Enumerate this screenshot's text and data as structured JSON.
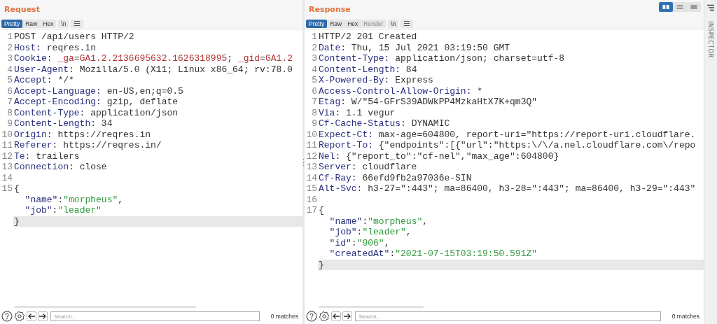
{
  "panes": [
    {
      "title": "Request",
      "tabs": [
        {
          "label": "Pretty",
          "selected": true,
          "disabled": false
        },
        {
          "label": "Raw",
          "selected": false,
          "disabled": false
        },
        {
          "label": "Hex",
          "selected": false,
          "disabled": false
        }
      ],
      "newline_toggle": "\\n",
      "lines": [
        {
          "number": "1",
          "highlighted": false,
          "segments": [
            {
              "kind": "plain",
              "text": "POST /api/users HTTP/2"
            }
          ]
        },
        {
          "number": "2",
          "highlighted": false,
          "segments": [
            {
              "kind": "key",
              "text": "Host:"
            },
            {
              "kind": "plain",
              "text": " reqres.in"
            }
          ]
        },
        {
          "number": "3",
          "highlighted": false,
          "segments": [
            {
              "kind": "key",
              "text": "Cookie:"
            },
            {
              "kind": "cookie",
              "text": " _ga"
            },
            {
              "kind": "plain",
              "text": "="
            },
            {
              "kind": "cookie",
              "text": "GA1.2.2136695632.1626318995"
            },
            {
              "kind": "plain",
              "text": "; "
            },
            {
              "kind": "cookie",
              "text": "_gid"
            },
            {
              "kind": "plain",
              "text": "="
            },
            {
              "kind": "cookie",
              "text": "GA1.2"
            }
          ]
        },
        {
          "number": "4",
          "highlighted": false,
          "segments": [
            {
              "kind": "key",
              "text": "User-Agent:"
            },
            {
              "kind": "plain",
              "text": " Mozilla/5.0 (X11; Linux x86_64; rv:78.0"
            }
          ]
        },
        {
          "number": "5",
          "highlighted": false,
          "segments": [
            {
              "kind": "key",
              "text": "Accept:"
            },
            {
              "kind": "plain",
              "text": " */*"
            }
          ]
        },
        {
          "number": "6",
          "highlighted": false,
          "segments": [
            {
              "kind": "key",
              "text": "Accept-Language:"
            },
            {
              "kind": "plain",
              "text": " en-US,en;q=0.5"
            }
          ]
        },
        {
          "number": "7",
          "highlighted": false,
          "segments": [
            {
              "kind": "key",
              "text": "Accept-Encoding:"
            },
            {
              "kind": "plain",
              "text": " gzip, deflate"
            }
          ]
        },
        {
          "number": "8",
          "highlighted": false,
          "segments": [
            {
              "kind": "key",
              "text": "Content-Type:"
            },
            {
              "kind": "plain",
              "text": " application/json"
            }
          ]
        },
        {
          "number": "9",
          "highlighted": false,
          "segments": [
            {
              "kind": "key",
              "text": "Content-Length:"
            },
            {
              "kind": "plain",
              "text": " 34"
            }
          ]
        },
        {
          "number": "10",
          "highlighted": false,
          "segments": [
            {
              "kind": "key",
              "text": "Origin:"
            },
            {
              "kind": "plain",
              "text": " https://reqres.in"
            }
          ]
        },
        {
          "number": "11",
          "highlighted": false,
          "segments": [
            {
              "kind": "key",
              "text": "Referer:"
            },
            {
              "kind": "plain",
              "text": " https://reqres.in/"
            }
          ]
        },
        {
          "number": "12",
          "highlighted": false,
          "segments": [
            {
              "kind": "key",
              "text": "Te:"
            },
            {
              "kind": "plain",
              "text": " trailers"
            }
          ]
        },
        {
          "number": "13",
          "highlighted": false,
          "segments": [
            {
              "kind": "key",
              "text": "Connection:"
            },
            {
              "kind": "plain",
              "text": " close"
            }
          ]
        },
        {
          "number": "14",
          "highlighted": false
        },
        {
          "number": "15",
          "highlighted": false,
          "segments": [
            {
              "kind": "plain",
              "text": "{"
            }
          ]
        },
        {
          "highlighted": false,
          "segments": [
            {
              "kind": "jsonkey",
              "text": "  \"name\""
            },
            {
              "kind": "plain",
              "text": ":"
            },
            {
              "kind": "string",
              "text": "\"morpheus\""
            },
            {
              "kind": "plain",
              "text": ","
            }
          ]
        },
        {
          "highlighted": false,
          "segments": [
            {
              "kind": "jsonkey",
              "text": "  \"job\""
            },
            {
              "kind": "plain",
              "text": ":"
            },
            {
              "kind": "string",
              "text": "\"leader\""
            }
          ]
        },
        {
          "highlighted": true,
          "segments": [
            {
              "kind": "plain",
              "text": "}"
            }
          ]
        }
      ],
      "search": {
        "placeholder": "Search..."
      },
      "match_count": "0 matches"
    },
    {
      "title": "Response",
      "tabs": [
        {
          "label": "Pretty",
          "selected": true,
          "disabled": false
        },
        {
          "label": "Raw",
          "selected": false,
          "disabled": false
        },
        {
          "label": "Hex",
          "selected": false,
          "disabled": false
        },
        {
          "label": "Render",
          "selected": false,
          "disabled": true
        }
      ],
      "newline_toggle": "\\n",
      "lines": [
        {
          "number": "1",
          "highlighted": false,
          "segments": [
            {
              "kind": "plain",
              "text": "HTTP/2 201 Created"
            }
          ]
        },
        {
          "number": "2",
          "highlighted": false,
          "segments": [
            {
              "kind": "key",
              "text": "Date:"
            },
            {
              "kind": "plain",
              "text": " Thu, 15 Jul 2021 03:19:50 GMT"
            }
          ]
        },
        {
          "number": "3",
          "highlighted": false,
          "segments": [
            {
              "kind": "key",
              "text": "Content-Type:"
            },
            {
              "kind": "plain",
              "text": " application/json; charset=utf-8"
            }
          ]
        },
        {
          "number": "4",
          "highlighted": false,
          "segments": [
            {
              "kind": "key",
              "text": "Content-Length:"
            },
            {
              "kind": "plain",
              "text": " 84"
            }
          ]
        },
        {
          "number": "5",
          "highlighted": false,
          "segments": [
            {
              "kind": "key",
              "text": "X-Powered-By:"
            },
            {
              "kind": "plain",
              "text": " Express"
            }
          ]
        },
        {
          "number": "6",
          "highlighted": false,
          "segments": [
            {
              "kind": "key",
              "text": "Access-Control-Allow-Origin:"
            },
            {
              "kind": "plain",
              "text": " *"
            }
          ]
        },
        {
          "number": "7",
          "highlighted": false,
          "segments": [
            {
              "kind": "key",
              "text": "Etag:"
            },
            {
              "kind": "plain",
              "text": " W/\"54-GFrS39ADWkPP4MzkaHtX7K+qm3Q\""
            }
          ]
        },
        {
          "number": "8",
          "highlighted": false,
          "segments": [
            {
              "kind": "key",
              "text": "Via:"
            },
            {
              "kind": "plain",
              "text": " 1.1 vegur"
            }
          ]
        },
        {
          "number": "9",
          "highlighted": false,
          "segments": [
            {
              "kind": "key",
              "text": "Cf-Cache-Status:"
            },
            {
              "kind": "plain",
              "text": " DYNAMIC"
            }
          ]
        },
        {
          "number": "10",
          "highlighted": false,
          "segments": [
            {
              "kind": "key",
              "text": "Expect-Ct:"
            },
            {
              "kind": "plain",
              "text": " max-age=604800, report-uri=\"https://report-uri.cloudflare."
            }
          ]
        },
        {
          "number": "11",
          "highlighted": false,
          "segments": [
            {
              "kind": "key",
              "text": "Report-To:"
            },
            {
              "kind": "plain",
              "text": " {\"endpoints\":[{\"url\":\"https:\\/\\/a.nel.cloudflare.com\\/repo"
            }
          ]
        },
        {
          "number": "12",
          "highlighted": false,
          "segments": [
            {
              "kind": "key",
              "text": "Nel:"
            },
            {
              "kind": "plain",
              "text": " {\"report_to\":\"cf-nel\",\"max_age\":604800}"
            }
          ]
        },
        {
          "number": "13",
          "highlighted": false,
          "segments": [
            {
              "kind": "key",
              "text": "Server:"
            },
            {
              "kind": "plain",
              "text": " cloudflare"
            }
          ]
        },
        {
          "number": "14",
          "highlighted": false,
          "segments": [
            {
              "kind": "key",
              "text": "Cf-Ray:"
            },
            {
              "kind": "plain",
              "text": " 66efd9fb2a97036e-SIN"
            }
          ]
        },
        {
          "number": "15",
          "highlighted": false,
          "segments": [
            {
              "kind": "key",
              "text": "Alt-Svc:"
            },
            {
              "kind": "plain",
              "text": " h3-27=\":443\"; ma=86400, h3-28=\":443\"; ma=86400, h3-29=\":443\""
            }
          ]
        },
        {
          "number": "16",
          "highlighted": false
        },
        {
          "number": "17",
          "highlighted": false,
          "segments": [
            {
              "kind": "plain",
              "text": "{"
            }
          ]
        },
        {
          "highlighted": false,
          "segments": [
            {
              "kind": "jsonkey",
              "text": "  \"name\""
            },
            {
              "kind": "plain",
              "text": ":"
            },
            {
              "kind": "string",
              "text": "\"morpheus\""
            },
            {
              "kind": "plain",
              "text": ","
            }
          ]
        },
        {
          "highlighted": false,
          "segments": [
            {
              "kind": "jsonkey",
              "text": "  \"job\""
            },
            {
              "kind": "plain",
              "text": ":"
            },
            {
              "kind": "string",
              "text": "\"leader\""
            },
            {
              "kind": "plain",
              "text": ","
            }
          ]
        },
        {
          "highlighted": false,
          "segments": [
            {
              "kind": "jsonkey",
              "text": "  \"id\""
            },
            {
              "kind": "plain",
              "text": ":"
            },
            {
              "kind": "string",
              "text": "\"906\""
            },
            {
              "kind": "plain",
              "text": ","
            }
          ]
        },
        {
          "highlighted": false,
          "segments": [
            {
              "kind": "jsonkey",
              "text": "  \"createdAt\""
            },
            {
              "kind": "plain",
              "text": ":"
            },
            {
              "kind": "string",
              "text": "\"2021-07-15T03:19:50.591Z\""
            }
          ]
        },
        {
          "highlighted": true,
          "segments": [
            {
              "kind": "plain",
              "text": "}"
            }
          ]
        }
      ],
      "search": {
        "placeholder": "Search..."
      },
      "match_count": "0 matches"
    }
  ],
  "layout_buttons": [
    {
      "kind": "columns",
      "selected": true
    },
    {
      "kind": "rows",
      "selected": false
    },
    {
      "kind": "single",
      "selected": false
    }
  ],
  "sidebar": {
    "label": "INSPECTOR"
  }
}
